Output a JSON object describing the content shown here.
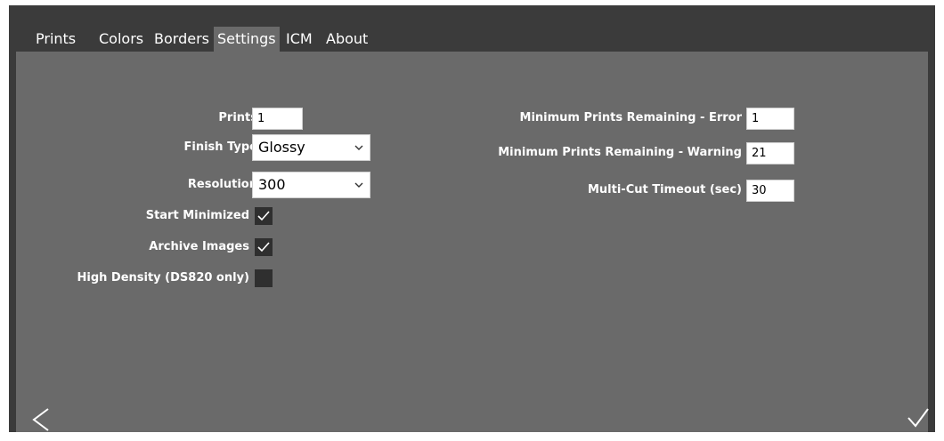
{
  "tabs": [
    {
      "label": "Prints"
    },
    {
      "label": "Colors"
    },
    {
      "label": "Borders"
    },
    {
      "label": "Settings"
    },
    {
      "label": "ICM"
    },
    {
      "label": "About"
    }
  ],
  "active_tab": "Settings",
  "left": {
    "prints_label": "Prints",
    "prints_value": "1",
    "finish_label": "Finish Type",
    "finish_value": "Glossy",
    "resolution_label": "Resolution",
    "resolution_value": "300",
    "start_min_label": "Start Minimized",
    "start_min_checked": true,
    "archive_label": "Archive Images",
    "archive_checked": true,
    "high_density_label": "High Density (DS820 only)",
    "high_density_checked": false
  },
  "right": {
    "min_error_label": "Minimum Prints Remaining - Error",
    "min_error_value": "1",
    "min_warning_label": "Minimum Prints Remaining - Warning",
    "min_warning_value": "21",
    "multicut_label": "Multi-Cut Timeout (sec)",
    "multicut_value": "30"
  },
  "icons": {
    "back": "chevron-left-icon",
    "confirm": "checkmark-icon",
    "dropdown": "chevron-down-icon"
  }
}
